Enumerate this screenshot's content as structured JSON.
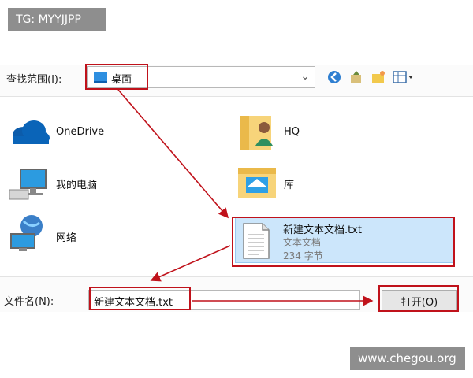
{
  "watermarks": {
    "top": "TG: MYYJJPP",
    "bottom": "www.chegou.org"
  },
  "dialog": {
    "lookin_label": "查找范围(I):",
    "lookin_value": "桌面",
    "items": [
      {
        "label": "OneDrive",
        "icon": "cloud-icon"
      },
      {
        "label": "HQ",
        "icon": "user-folder-icon"
      },
      {
        "label": "我的电脑",
        "icon": "computer-icon"
      },
      {
        "label": "库",
        "icon": "library-icon"
      },
      {
        "label": "网络",
        "icon": "network-icon"
      }
    ],
    "selected_file": {
      "name": "新建文本文档.txt",
      "type": "文本文档",
      "size": "234 字节"
    },
    "filename_label": "文件名(N):",
    "filename_value": "新建文本文档.txt",
    "open_button": "打开(O)"
  },
  "colors": {
    "annotation": "#c0121b",
    "selection": "#cce6fb",
    "accent": "#2e8fe0"
  }
}
